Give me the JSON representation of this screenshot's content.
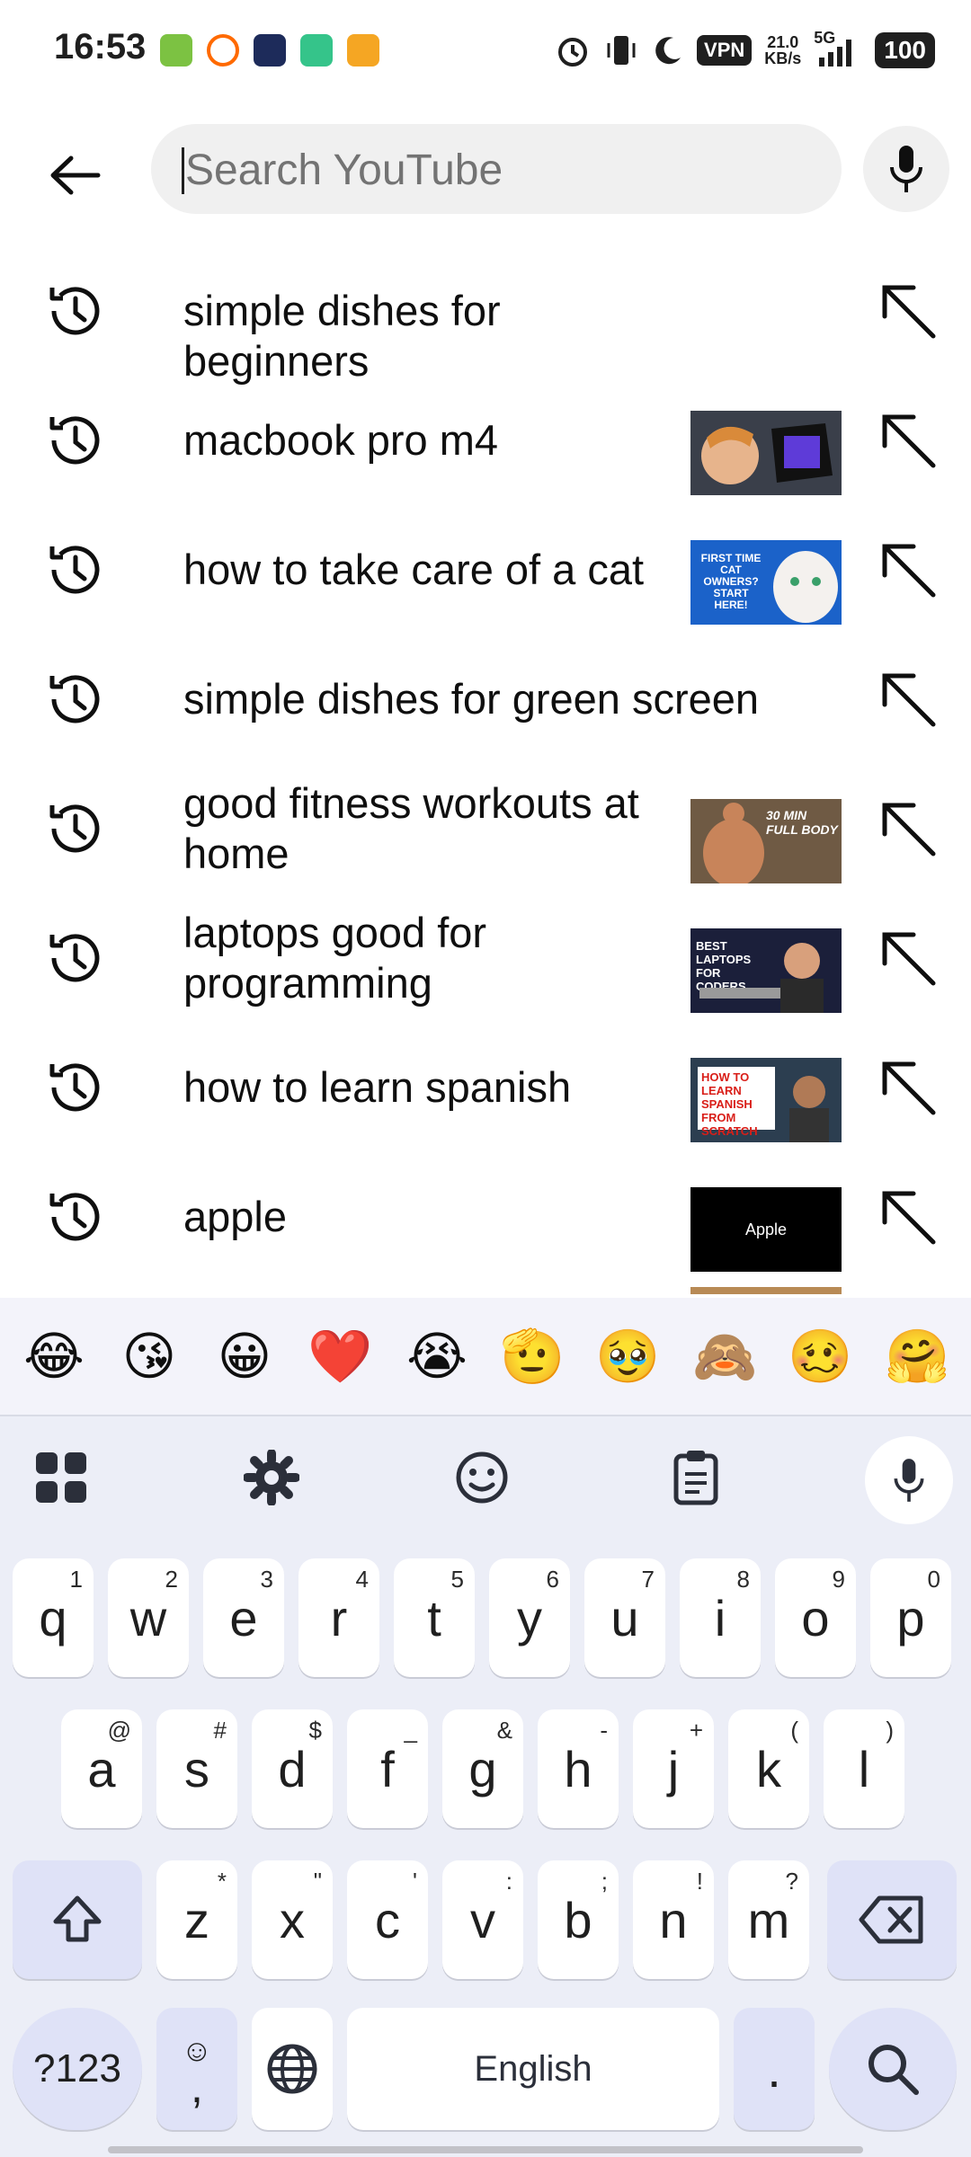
{
  "status_bar": {
    "time": "16:53",
    "vpn": "VPN",
    "speed_value": "21.0",
    "speed_unit": "KB/s",
    "network": "5G",
    "battery": "100"
  },
  "search": {
    "placeholder": "Search YouTube",
    "value": ""
  },
  "suggestions": [
    {
      "text": "simple dishes for beginners",
      "has_thumb": false
    },
    {
      "text": "macbook pro m4",
      "has_thumb": true
    },
    {
      "text": "how to take care of a cat",
      "has_thumb": true,
      "thumb_text": "FIRST TIME CAT OWNERS? START HERE!"
    },
    {
      "text": "simple dishes for green screen",
      "has_thumb": false
    },
    {
      "text": "good fitness workouts at home",
      "has_thumb": true,
      "thumb_text": "30 MIN FULL BODY"
    },
    {
      "text": "laptops good for programming",
      "has_thumb": true,
      "thumb_text": "BEST LAPTOPS FOR CODERS"
    },
    {
      "text": "how to learn spanish",
      "has_thumb": true,
      "thumb_text": "HOW TO LEARN SPANISH FROM SCRATCH"
    },
    {
      "text": "apple",
      "has_thumb": true,
      "thumb_text": "Apple"
    }
  ],
  "keyboard": {
    "emojis": [
      "😂",
      "😘",
      "😀",
      "❤️",
      "😭",
      "🫡",
      "🥹",
      "🙈",
      "🥴",
      "🤗"
    ],
    "row1": [
      {
        "k": "q",
        "s": "1"
      },
      {
        "k": "w",
        "s": "2"
      },
      {
        "k": "e",
        "s": "3"
      },
      {
        "k": "r",
        "s": "4"
      },
      {
        "k": "t",
        "s": "5"
      },
      {
        "k": "y",
        "s": "6"
      },
      {
        "k": "u",
        "s": "7"
      },
      {
        "k": "i",
        "s": "8"
      },
      {
        "k": "o",
        "s": "9"
      },
      {
        "k": "p",
        "s": "0"
      }
    ],
    "row2": [
      {
        "k": "a",
        "s": "@"
      },
      {
        "k": "s",
        "s": "#"
      },
      {
        "k": "d",
        "s": "$"
      },
      {
        "k": "f",
        "s": "_"
      },
      {
        "k": "g",
        "s": "&"
      },
      {
        "k": "h",
        "s": "-"
      },
      {
        "k": "j",
        "s": "+"
      },
      {
        "k": "k",
        "s": "("
      },
      {
        "k": "l",
        "s": ")"
      }
    ],
    "row3": [
      {
        "k": "z",
        "s": "*"
      },
      {
        "k": "x",
        "s": "\""
      },
      {
        "k": "c",
        "s": "'"
      },
      {
        "k": "v",
        "s": ":"
      },
      {
        "k": "b",
        "s": ";"
      },
      {
        "k": "n",
        "s": "!"
      },
      {
        "k": "m",
        "s": "?"
      }
    ],
    "symbols_label": "?123",
    "comma_label": ",",
    "space_label": "English",
    "period_label": "."
  }
}
